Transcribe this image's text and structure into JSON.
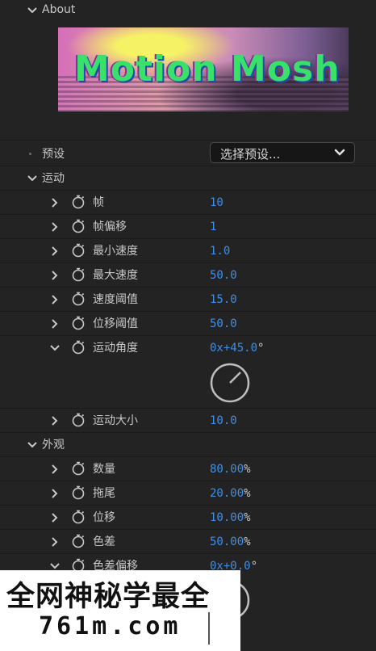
{
  "about": {
    "label": "About",
    "logo_text": "Motion Mosh"
  },
  "preset": {
    "label": "预设",
    "dropdown_value": "选择预设..."
  },
  "motion": {
    "label": "运动",
    "params": [
      {
        "label": "帧",
        "value": "10",
        "unit": ""
      },
      {
        "label": "帧偏移",
        "value": "1",
        "unit": ""
      },
      {
        "label": "最小速度",
        "value": "1.0",
        "unit": ""
      },
      {
        "label": "最大速度",
        "value": "50.0",
        "unit": ""
      },
      {
        "label": "速度阈值",
        "value": "15.0",
        "unit": ""
      },
      {
        "label": "位移阈值",
        "value": "50.0",
        "unit": ""
      }
    ],
    "angle": {
      "label": "运动角度",
      "value": "0x+45.0",
      "unit": "°"
    },
    "size": {
      "label": "运动大小",
      "value": "10.0",
      "unit": ""
    }
  },
  "appearance": {
    "label": "外观",
    "params": [
      {
        "label": "数量",
        "value": "80.00",
        "unit": "%"
      },
      {
        "label": "拖尾",
        "value": "20.00",
        "unit": "%"
      },
      {
        "label": "位移",
        "value": "10.00",
        "unit": "%"
      },
      {
        "label": "色差",
        "value": "50.00",
        "unit": "%"
      }
    ],
    "chroma_offset": {
      "label": "色差偏移",
      "value": "0x+0.0",
      "unit": "°"
    }
  },
  "watermark": {
    "line1": "全网神秘学最全",
    "line2": "761m.com"
  },
  "colors": {
    "value_blue": "#3f8fe8",
    "panel_bg": "#232323"
  }
}
